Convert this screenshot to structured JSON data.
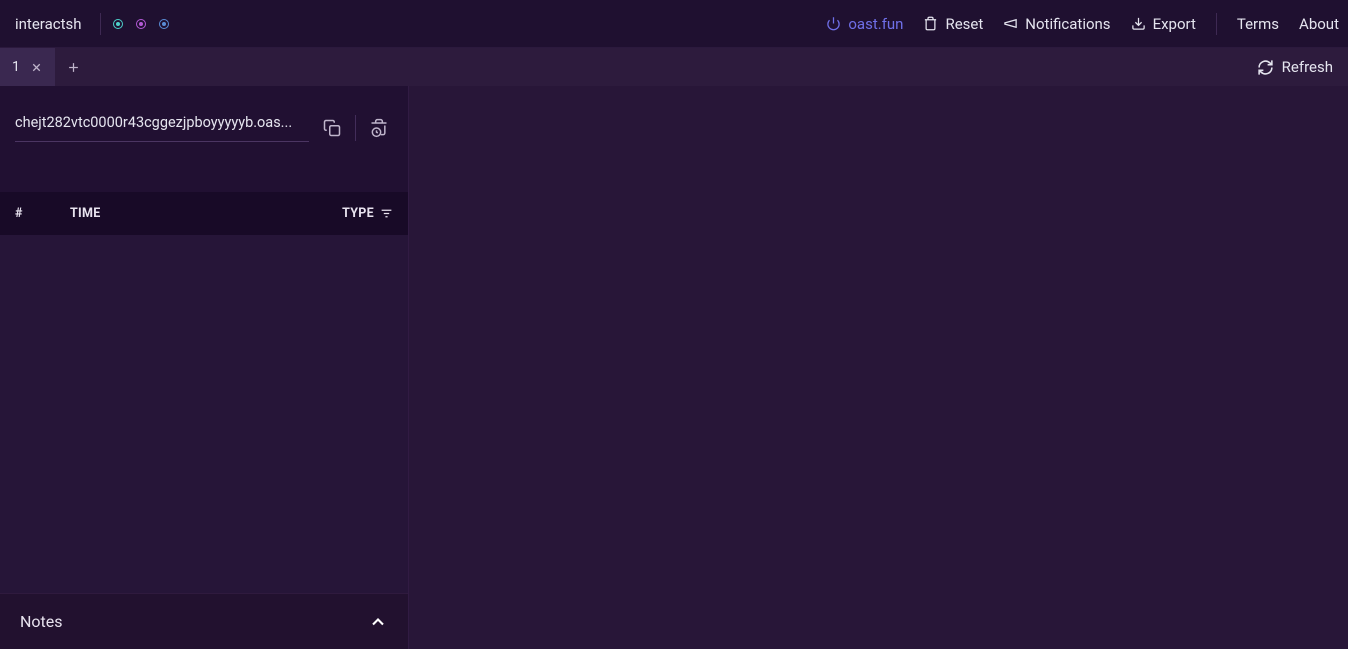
{
  "header": {
    "brand": "interactsh",
    "host": "oast.fun",
    "nav": {
      "reset": "Reset",
      "notifications": "Notifications",
      "export": "Export",
      "terms": "Terms",
      "about": "About"
    }
  },
  "tabBar": {
    "tabs": [
      {
        "label": "1"
      }
    ],
    "refresh": "Refresh"
  },
  "sidebar": {
    "url": "chejt282vtc0000r43cggezjpboyyyyyb.oas...",
    "columns": {
      "index": "#",
      "time": "TIME",
      "type": "TYPE"
    },
    "notes": "Notes"
  }
}
